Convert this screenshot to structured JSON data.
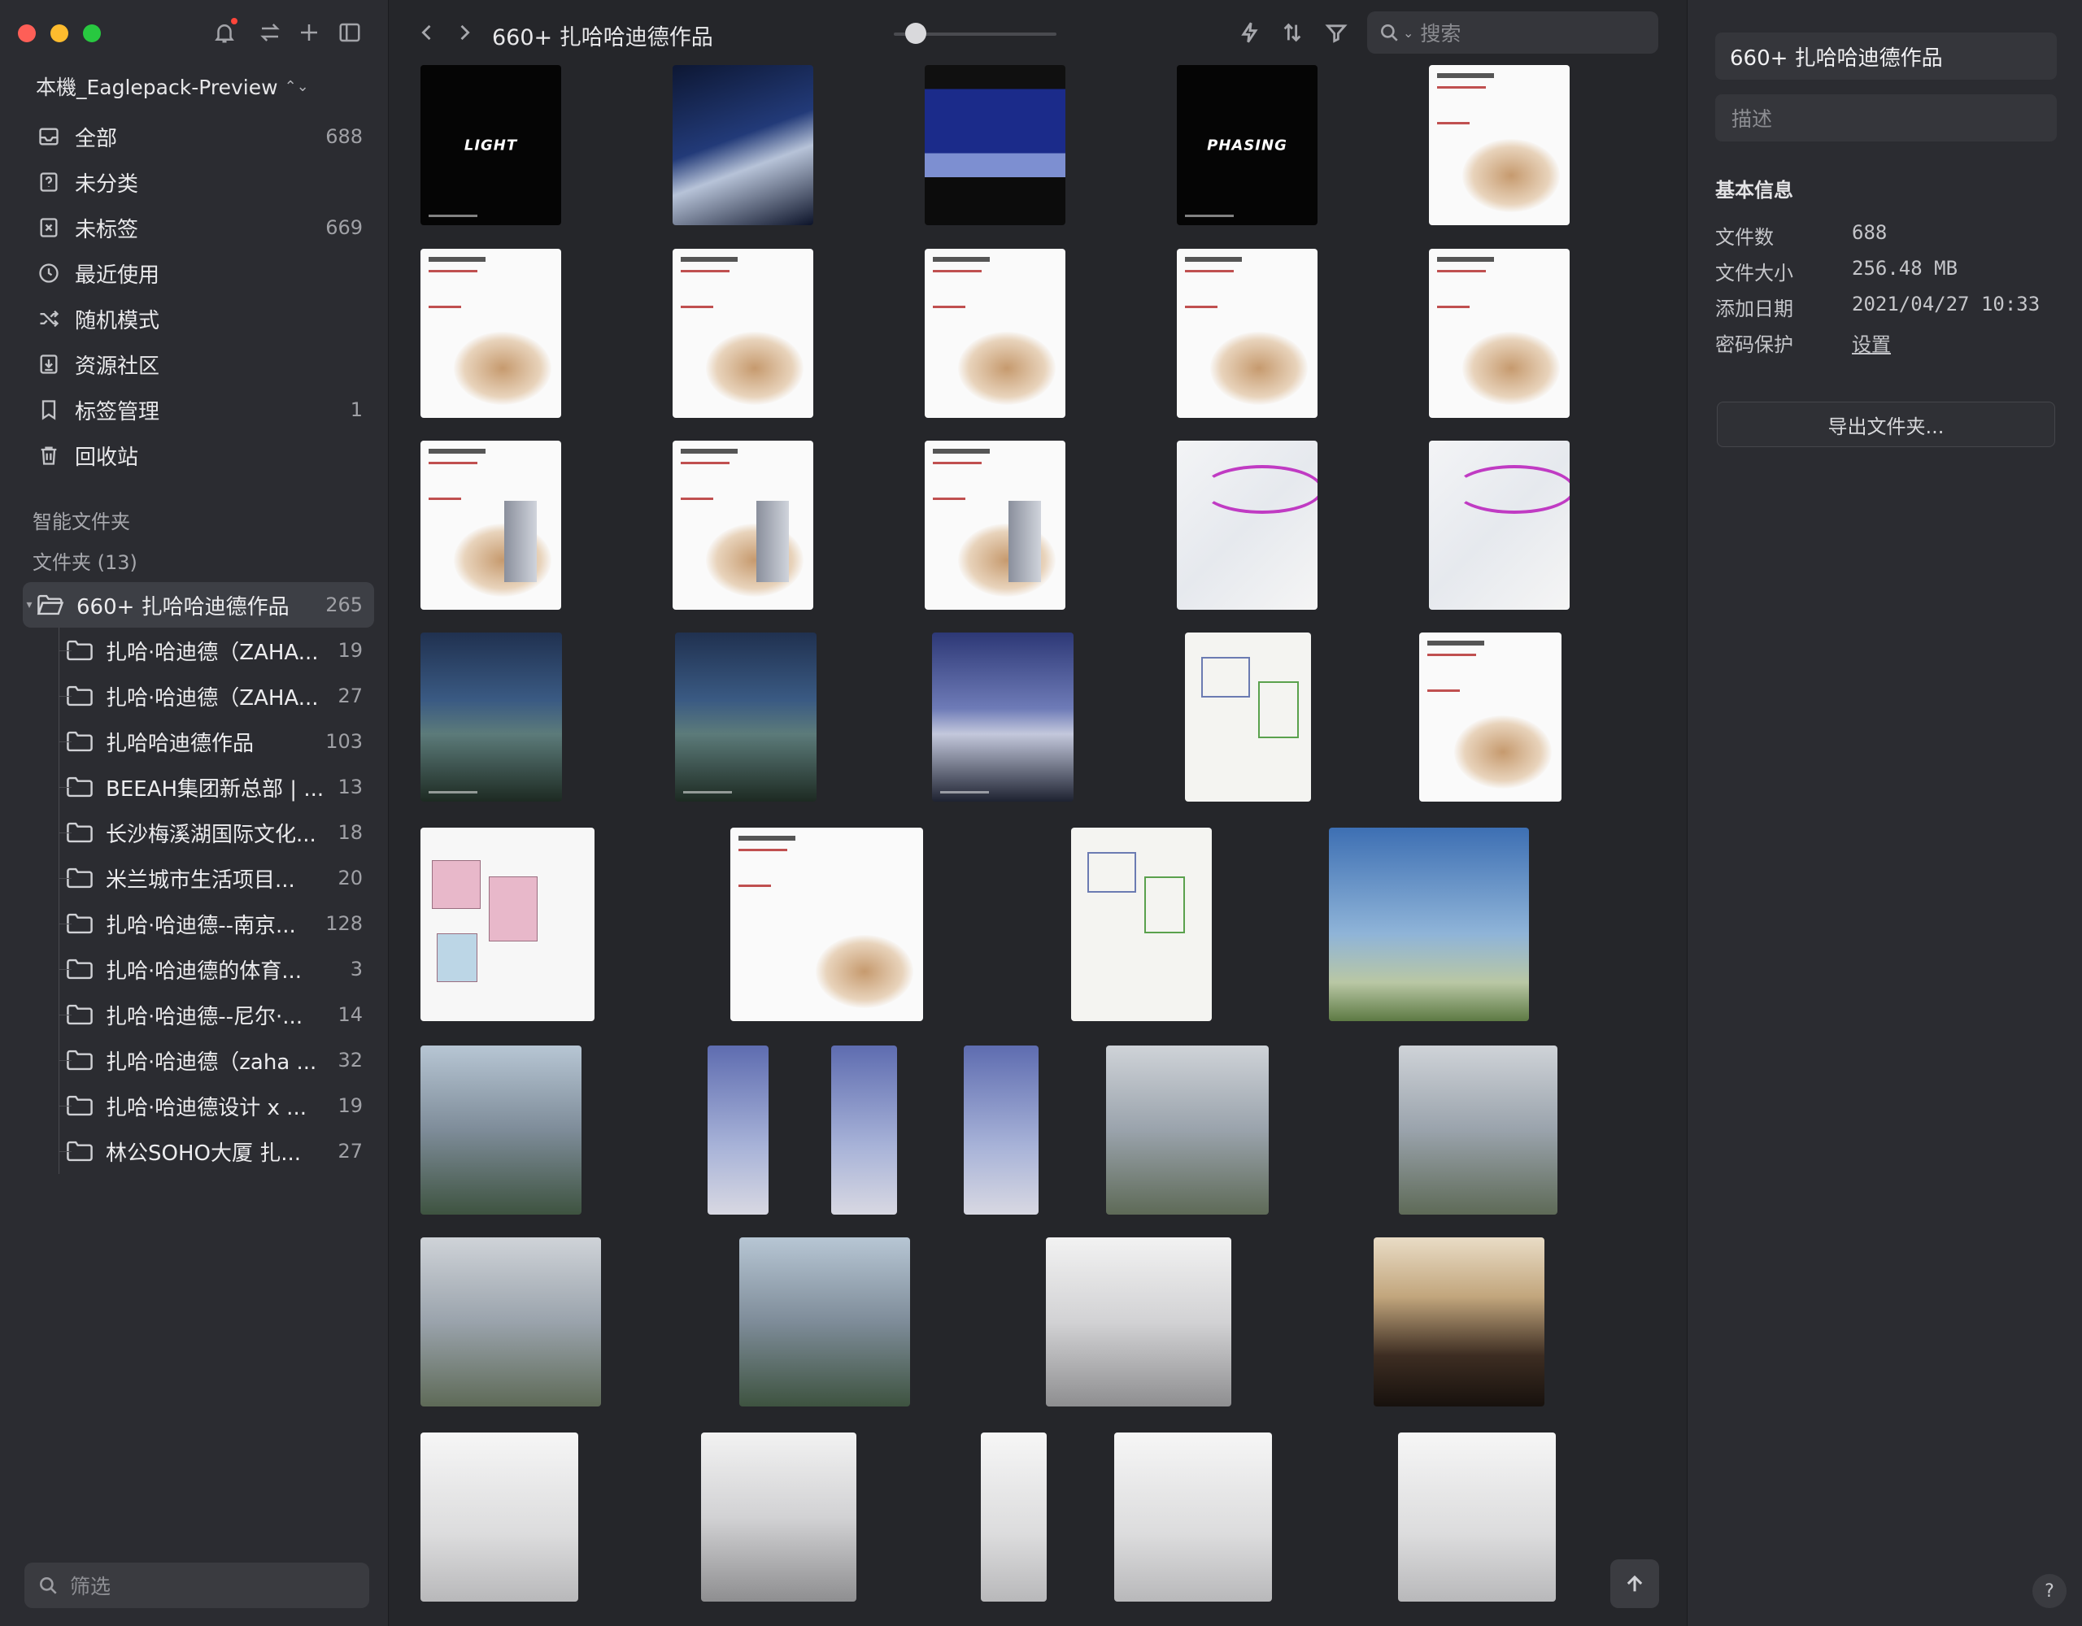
{
  "sidebar": {
    "library": "本機_Eaglepack-Preview",
    "nav": [
      {
        "label": "全部",
        "count": "688",
        "icon": "inbox-icon"
      },
      {
        "label": "未分类",
        "count": "",
        "icon": "question-box-icon"
      },
      {
        "label": "未标签",
        "count": "669",
        "icon": "untagged-icon"
      },
      {
        "label": "最近使用",
        "count": "",
        "icon": "clock-icon"
      },
      {
        "label": "随机模式",
        "count": "",
        "icon": "shuffle-icon"
      },
      {
        "label": "资源社区",
        "count": "",
        "icon": "download-box-icon"
      },
      {
        "label": "标签管理",
        "count": "1",
        "icon": "bookmark-icon"
      },
      {
        "label": "回收站",
        "count": "",
        "icon": "trash-icon"
      }
    ],
    "smart_folders_title": "智能文件夹",
    "folders_title": "文件夹 (13)",
    "folders": [
      {
        "label": "660+ 扎哈哈迪德作品",
        "count": "265",
        "selected": true
      },
      {
        "label": "扎哈·哈迪德（ZAHA...",
        "count": "19"
      },
      {
        "label": "扎哈·哈迪德（ZAHA...",
        "count": "27"
      },
      {
        "label": "扎哈哈迪德作品",
        "count": "103"
      },
      {
        "label": "BEEAH集团新总部 | ...",
        "count": "13"
      },
      {
        "label": "长沙梅溪湖国际文化...",
        "count": "18"
      },
      {
        "label": "米兰城市生活项目...",
        "count": "20"
      },
      {
        "label": "扎哈·哈迪德--南京...",
        "count": "128"
      },
      {
        "label": "扎哈·哈迪德的体育...",
        "count": "3"
      },
      {
        "label": "扎哈·哈迪德--尼尔·...",
        "count": "14"
      },
      {
        "label": "扎哈·哈迪德（zaha ...",
        "count": "32"
      },
      {
        "label": "扎哈·哈迪德设计 x ...",
        "count": "19"
      },
      {
        "label": "林公SOHO大厦 扎...",
        "count": "27"
      }
    ],
    "filter_placeholder": "筛选"
  },
  "toolbar": {
    "title": "660+ 扎哈哈迪德作品",
    "search_placeholder": "搜索"
  },
  "thumbnails": {
    "light_label": "LIGHT",
    "phasing_label": "PHASING"
  },
  "inspector": {
    "title": "660+ 扎哈哈迪德作品",
    "desc_placeholder": "描述",
    "section": "基本信息",
    "rows": [
      {
        "key": "文件数",
        "value": "688"
      },
      {
        "key": "文件大小",
        "value": "256.48 MB"
      },
      {
        "key": "添加日期",
        "value": "2021/04/27 10:33"
      },
      {
        "key": "密码保护",
        "value": "设置"
      }
    ],
    "export_label": "导出文件夹...",
    "help_label": "?"
  }
}
